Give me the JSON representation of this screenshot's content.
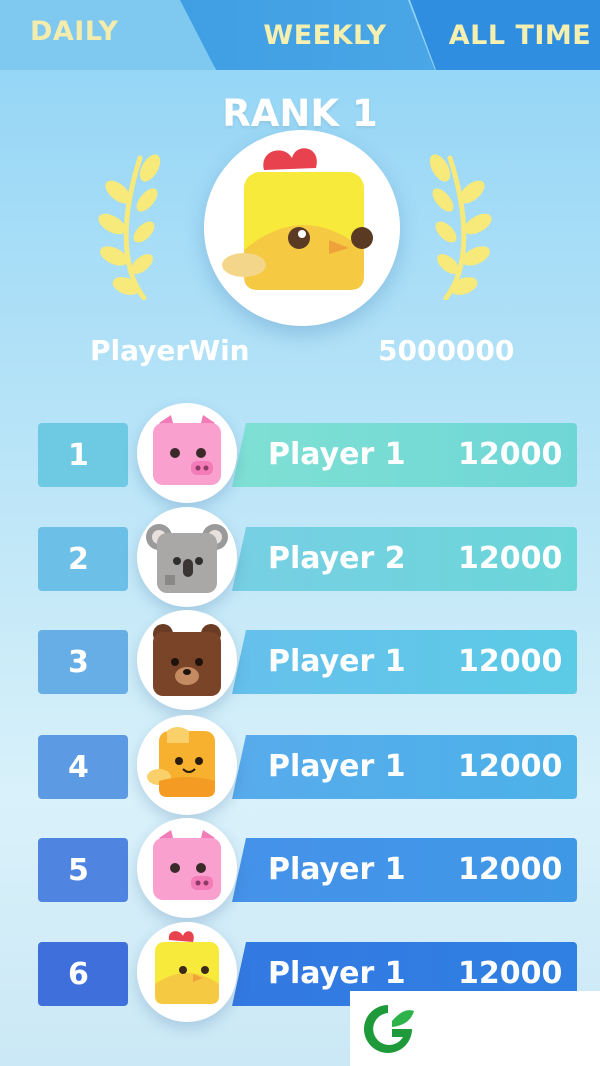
{
  "tabs": {
    "daily": "DAILY",
    "weekly": "WEEKLY",
    "all_time": "ALL TIME"
  },
  "hero": {
    "rank_label": "RANK 1",
    "player_name": "PlayerWin",
    "score": "5000000",
    "avatar_icon": "chick-icon"
  },
  "leaderboard": [
    {
      "rank": "1",
      "name": "Player 1",
      "score": "12000",
      "avatar_icon": "pig-icon",
      "bar_color": "#6fdad0",
      "tab_color": "#6ec9e3"
    },
    {
      "rank": "2",
      "name": "Player 2",
      "score": "12000",
      "avatar_icon": "koala-icon",
      "bar_color": "#6bd0e0",
      "tab_color": "#6cbfe6"
    },
    {
      "rank": "3",
      "name": "Player 1",
      "score": "12000",
      "avatar_icon": "bear-icon",
      "bar_color": "#5cbde9",
      "tab_color": "#67aee6"
    },
    {
      "rank": "4",
      "name": "Player 1",
      "score": "12000",
      "avatar_icon": "cat-icon",
      "bar_color": "#4aa6ea",
      "tab_color": "#5c9be4"
    },
    {
      "rank": "5",
      "name": "Player 1",
      "score": "12000",
      "avatar_icon": "pig-icon",
      "bar_color": "#3d8de6",
      "tab_color": "#4f85e0"
    },
    {
      "rank": "6",
      "name": "Player 1",
      "score": "12000",
      "avatar_icon": "chick-icon",
      "bar_color": "#2f77e0",
      "tab_color": "#3f6fdb"
    }
  ],
  "watermark_icon": "g-leaf-logo-icon"
}
